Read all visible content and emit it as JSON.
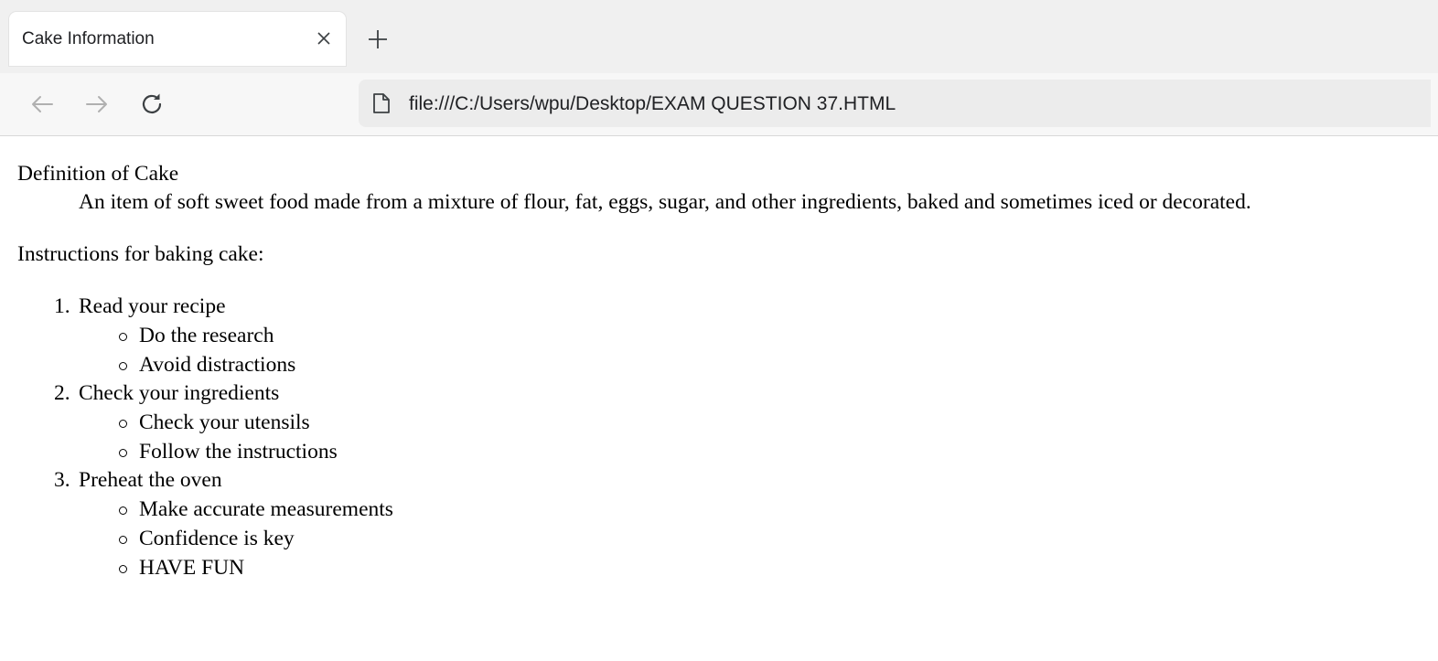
{
  "browser": {
    "tab_title": "Cake Information",
    "tab_close_icon": "close-icon",
    "new_tab_icon": "plus-icon",
    "back_icon": "arrow-left-icon",
    "forward_icon": "arrow-right-icon",
    "reload_icon": "reload-icon",
    "page_icon": "file-icon",
    "url": "file:///C:/Users/wpu/Desktop/EXAM QUESTION 37.HTML"
  },
  "page": {
    "definition_term": "Definition of Cake",
    "definition_desc": "An item of soft sweet food made from a mixture of flour, fat, eggs, sugar, and other ingredients, baked and sometimes iced or decorated.",
    "instructions_heading": "Instructions for baking cake:",
    "steps": [
      {
        "number": "1.",
        "label": "Read your recipe",
        "subitems": [
          "Do the research",
          "Avoid distractions"
        ]
      },
      {
        "number": "2.",
        "label": "Check your ingredients",
        "subitems": [
          "Check your utensils",
          "Follow the instructions"
        ]
      },
      {
        "number": "3.",
        "label": "Preheat the oven",
        "subitems": [
          "Make accurate measurements",
          "Confidence is key",
          "HAVE FUN"
        ]
      }
    ]
  }
}
